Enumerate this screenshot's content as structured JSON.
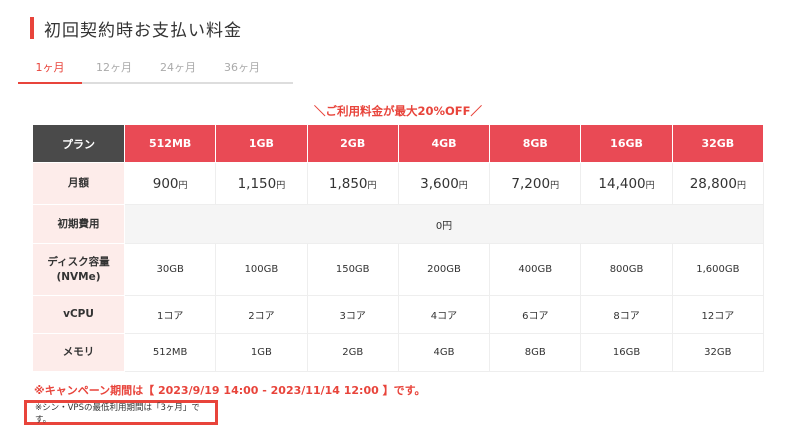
{
  "section": {
    "title": "初回契約時お支払い料金",
    "accent_color": "#e8443b"
  },
  "tabs": [
    {
      "label": "1ヶ月",
      "active": true
    },
    {
      "label": "12ヶ月",
      "active": false
    },
    {
      "label": "24ヶ月",
      "active": false
    },
    {
      "label": "36ヶ月",
      "active": false
    }
  ],
  "campaign_banner": "＼ご利用料金が最大20%OFF／",
  "table": {
    "plan_header": "プラン",
    "plans": [
      "512MB",
      "1GB",
      "2GB",
      "4GB",
      "8GB",
      "16GB",
      "32GB"
    ],
    "monthly": {
      "label": "月額",
      "values": [
        "900",
        "1,150",
        "1,850",
        "3,600",
        "7,200",
        "14,400",
        "28,800"
      ],
      "unit": "円"
    },
    "initial_fee": {
      "label": "初期費用",
      "value": "0円"
    },
    "disk": {
      "label_line1": "ディスク容量",
      "label_line2": "(NVMe)",
      "values": [
        "30GB",
        "100GB",
        "150GB",
        "200GB",
        "400GB",
        "800GB",
        "1,600GB"
      ]
    },
    "vcpu": {
      "label": "vCPU",
      "values": [
        "1コア",
        "2コア",
        "3コア",
        "4コア",
        "6コア",
        "8コア",
        "12コア"
      ]
    },
    "memory": {
      "label": "メモリ",
      "values": [
        "512MB",
        "1GB",
        "2GB",
        "4GB",
        "8GB",
        "16GB",
        "32GB"
      ]
    }
  },
  "notes": {
    "campaign_period": "※キャンペーン期間は【 2023/9/19 14:00 - 2023/11/14 12:00 】です。",
    "minimum_period": "※シン・VPSの最低利用期間は「3ヶ月」です。"
  }
}
